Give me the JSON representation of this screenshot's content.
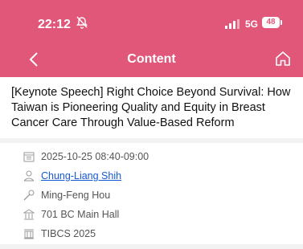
{
  "status_bar": {
    "time": "22:12",
    "network": "5G",
    "battery": "48"
  },
  "nav": {
    "title": "Content"
  },
  "talk": {
    "title": "[Keynote Speech] Right Choice Beyond Survival: How Taiwan is Pioneering Quality and Equity in Breast Cancer Care Through Value-Based Reform"
  },
  "details": {
    "datetime": "2025-10-25 08:40-09:00",
    "speaker": "Chung-Liang Shih",
    "moderator": "Ming-Feng Hou",
    "room": "701 BC Main Hall",
    "event": "TIBCS 2025"
  },
  "colors": {
    "brand": "#e0577a",
    "link": "#1558d6"
  }
}
